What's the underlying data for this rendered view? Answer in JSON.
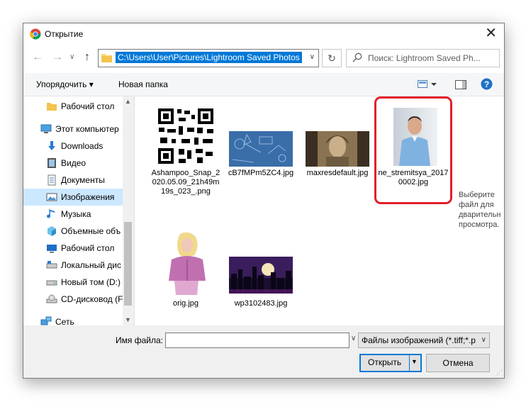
{
  "window": {
    "title": "Открытие",
    "close_glyph": "✕"
  },
  "nav": {
    "back_glyph": "←",
    "forward_glyph": "→",
    "dropdown_glyph": "∨",
    "up_glyph": "↑",
    "address": "C:\\Users\\User\\Pictures\\Lightroom Saved Photos",
    "refresh_glyph": "↻",
    "search_placeholder": "Поиск: Lightroom Saved Ph..."
  },
  "toolbar": {
    "organize": "Упорядочить ▾",
    "new_folder": "Новая папка",
    "help_glyph": "?"
  },
  "sidebar": {
    "items": [
      {
        "label": "Рабочий стол",
        "icon": "folder-icon"
      },
      {
        "label": "Этот компьютер",
        "icon": "computer-icon"
      },
      {
        "label": "Downloads",
        "icon": "download-icon"
      },
      {
        "label": "Видео",
        "icon": "video-icon"
      },
      {
        "label": "Документы",
        "icon": "document-icon"
      },
      {
        "label": "Изображения",
        "icon": "pictures-icon"
      },
      {
        "label": "Музыка",
        "icon": "music-icon"
      },
      {
        "label": "Объемные объ",
        "icon": "3d-objects-icon"
      },
      {
        "label": "Рабочий стол",
        "icon": "desktop-icon"
      },
      {
        "label": "Локальный дис",
        "icon": "drive-icon"
      },
      {
        "label": "Новый том (D:)",
        "icon": "drive-icon"
      },
      {
        "label": "CD-дисковод (F",
        "icon": "cd-drive-icon"
      },
      {
        "label": "Сеть",
        "icon": "network-icon"
      }
    ],
    "selected_index": 5,
    "scroll_up_glyph": "▲",
    "scroll_down_glyph": "▼"
  },
  "files": [
    {
      "name": "Ashampoo_Snap_2020.05.09_21h49m19s_023_.png",
      "thumb": "qr-code"
    },
    {
      "name": "cB7fMPm5ZC4.jpg",
      "thumb": "blueprint"
    },
    {
      "name": "maxresdefault.jpg",
      "thumb": "sepia-portrait"
    },
    {
      "name": "ne_stremitsya_20170002.jpg",
      "thumb": "man-photo"
    },
    {
      "name": "orig.jpg",
      "thumb": "girl-illustration"
    },
    {
      "name": "wp3102483.jpg",
      "thumb": "night-city"
    }
  ],
  "preview": {
    "text": "Выберите файл для дварительн просмотра."
  },
  "bottom": {
    "filename_label": "Имя файла:",
    "filename_value": "",
    "filter": "Файлы изображений (*.tiff;*.p",
    "open": "Открыть",
    "cancel": "Отмена"
  },
  "colors": {
    "accent": "#0078d7",
    "selection": "#cce8ff",
    "highlight": "#e0202a"
  }
}
